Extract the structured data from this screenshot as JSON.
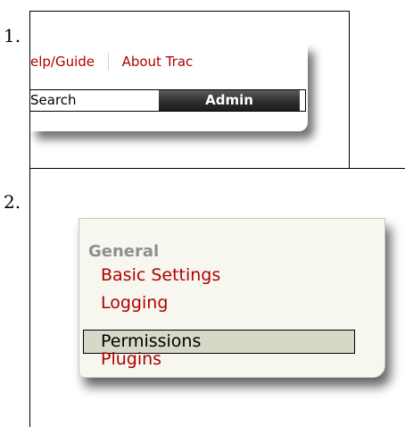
{
  "steps": {
    "step1_number": "1.",
    "step2_number": "2."
  },
  "metanav": {
    "help_label": "elp/Guide",
    "about_label": "About Trac"
  },
  "mainnav": {
    "search_label": "Search",
    "admin_label": "Admin"
  },
  "admin_menu": {
    "category": "General",
    "items": [
      {
        "label": "Basic Settings",
        "active": false
      },
      {
        "label": "Logging",
        "active": false
      },
      {
        "label": "Permissions",
        "active": true
      },
      {
        "label": "Plugins",
        "active": false
      }
    ]
  },
  "colors": {
    "link": "#b00000",
    "active_bg": "#d8d8c8",
    "panel_bg": "#f7f7f0",
    "admin_tab_bg": "#2e2e2e"
  }
}
